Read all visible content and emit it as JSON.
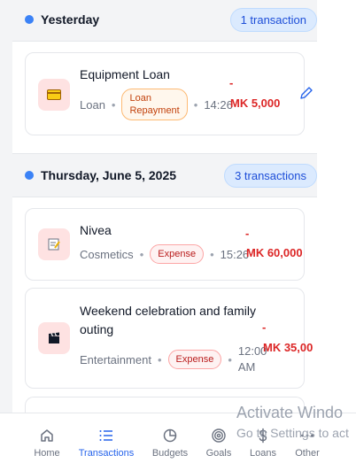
{
  "sections": [
    {
      "date": "Yesterday",
      "count": "1 transaction",
      "transactions": [
        {
          "icon": "money-icon",
          "title": "Equipment Loan",
          "category": "Loan",
          "type_label_line1": "Loan",
          "type_label_line2": "Repayment",
          "time": "14:26",
          "sign": "-",
          "amount": "MK 5,000"
        }
      ]
    },
    {
      "date": "Thursday, June 5, 2025",
      "count": "3 transactions",
      "transactions": [
        {
          "icon": "memo-icon",
          "title": "Nivea",
          "category": "Cosmetics",
          "type_label": "Expense",
          "time": "15:26",
          "sign": "-",
          "amount": "MK 60,000"
        },
        {
          "icon": "clapper-icon",
          "title": "Weekend celebration and family outing",
          "category": "Entertainment",
          "type_label": "Expense",
          "time_line1": "12:00",
          "time_line2": "AM",
          "sign": "-",
          "amount": "MK 35,00"
        }
      ]
    }
  ],
  "watermark": {
    "line1": "Activate Windo",
    "line2": "Go to Settings to act"
  },
  "nav": [
    {
      "label": "Home",
      "icon": "home-icon"
    },
    {
      "label": "Transactions",
      "icon": "list-icon",
      "active": true
    },
    {
      "label": "Budgets",
      "icon": "pie-chart-icon"
    },
    {
      "label": "Goals",
      "icon": "target-icon"
    },
    {
      "label": "Loans",
      "icon": "dollar-icon"
    },
    {
      "label": "Other",
      "icon": "more-icon"
    }
  ],
  "colors": {
    "accent": "#2563eb",
    "amount": "#dc2626",
    "badge_bg": "#dbeafe",
    "icon_bg": "#fee2e2"
  }
}
